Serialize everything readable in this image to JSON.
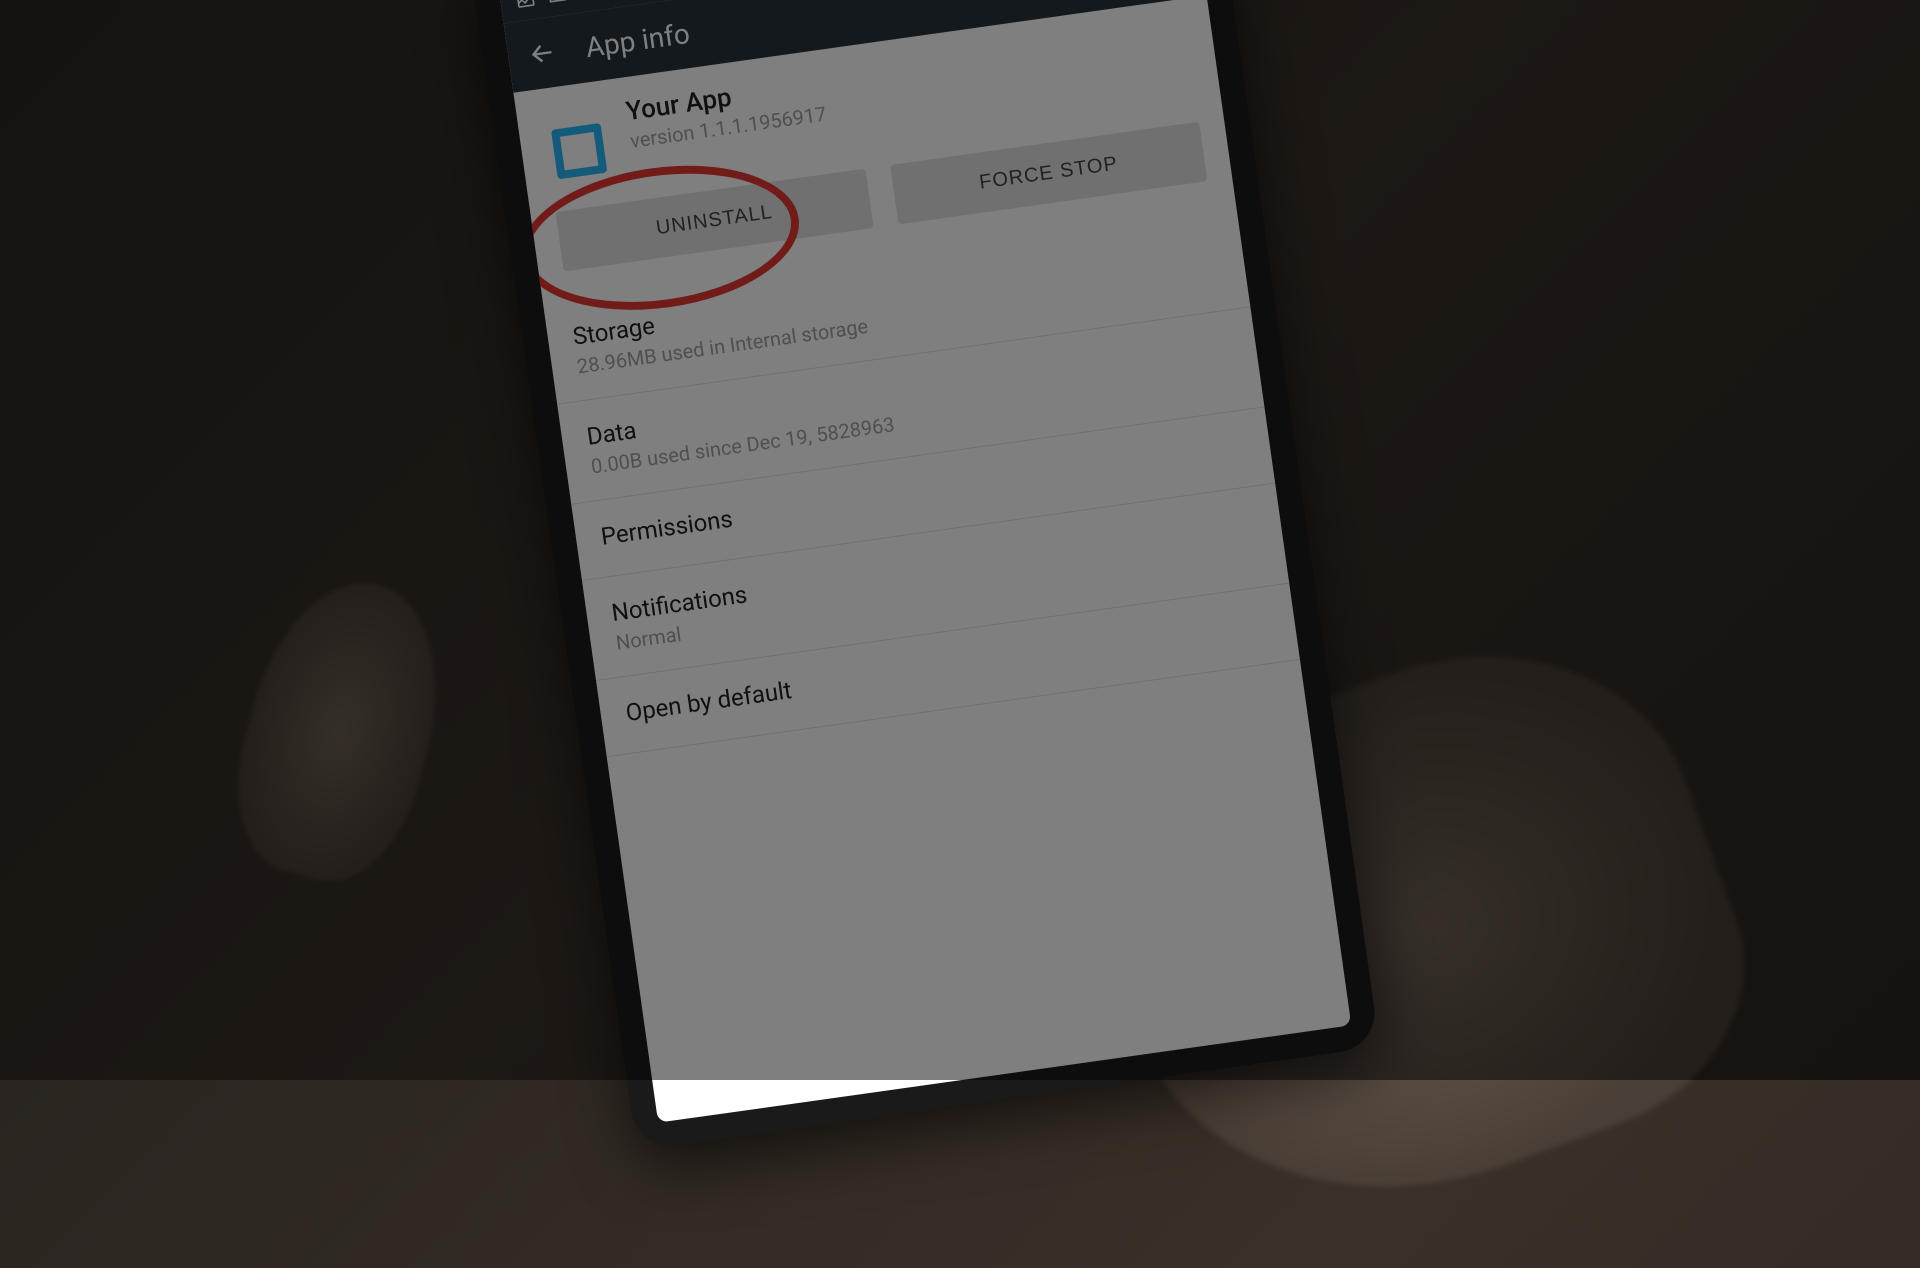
{
  "appbar": {
    "title": "App info"
  },
  "app": {
    "name": "Your App",
    "version": "version 1.1.1.1956917"
  },
  "buttons": {
    "uninstall": "UNINSTALL",
    "forcestop": "FORCE STOP"
  },
  "sections": {
    "storage": {
      "title": "Storage",
      "subtitle": "28.96MB used in Internal storage"
    },
    "data": {
      "title": "Data",
      "subtitle": "0.00B used since Dec 19, 5828963"
    },
    "permissions": {
      "title": "Permissions"
    },
    "notifications": {
      "title": "Notifications",
      "subtitle": "Normal"
    },
    "openbydefault": {
      "title": "Open by default"
    }
  }
}
